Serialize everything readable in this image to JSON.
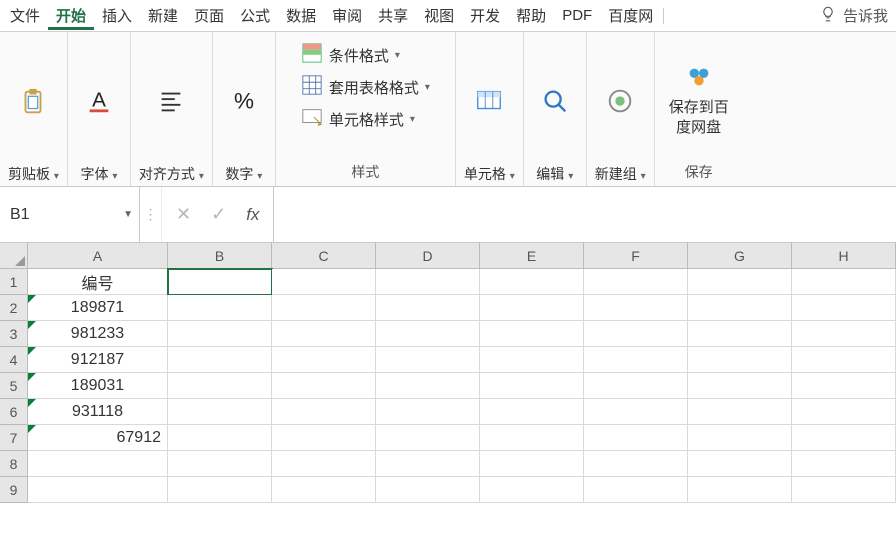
{
  "menu": {
    "items": [
      "文件",
      "开始",
      "插入",
      "新建",
      "页面",
      "公式",
      "数据",
      "审阅",
      "共享",
      "视图",
      "开发",
      "帮助",
      "PDF",
      "百度网"
    ],
    "active_index": 1,
    "tellme": "告诉我"
  },
  "ribbon": {
    "clipboard": {
      "label": "剪贴板"
    },
    "font": {
      "label": "字体"
    },
    "align": {
      "label": "对齐方式"
    },
    "number": {
      "label": "数字",
      "icon": "%"
    },
    "styles": {
      "label": "样式",
      "cond": "条件格式",
      "table": "套用表格格式",
      "cell": "单元格样式"
    },
    "cells": {
      "label": "单元格"
    },
    "edit": {
      "label": "编辑"
    },
    "newgroup": {
      "label": "新建组"
    },
    "save": {
      "label": "保存",
      "btn": "保存到百度网盘"
    }
  },
  "formula": {
    "namebox": "B1"
  },
  "columns": [
    "A",
    "B",
    "C",
    "D",
    "E",
    "F",
    "G",
    "H"
  ],
  "rows": [
    "1",
    "2",
    "3",
    "4",
    "5",
    "6",
    "7",
    "8",
    "9"
  ],
  "colA": {
    "header": "编号",
    "values": [
      "189871",
      "981233",
      "912187",
      "189031",
      "931118",
      "67912"
    ]
  },
  "selected": {
    "col": "B",
    "row": 1
  },
  "chart_data": {
    "type": "table",
    "title": "编号",
    "columns": [
      "编号"
    ],
    "rows": [
      [
        "189871"
      ],
      [
        "981233"
      ],
      [
        "912187"
      ],
      [
        "189031"
      ],
      [
        "931118"
      ],
      [
        "67912"
      ]
    ]
  }
}
